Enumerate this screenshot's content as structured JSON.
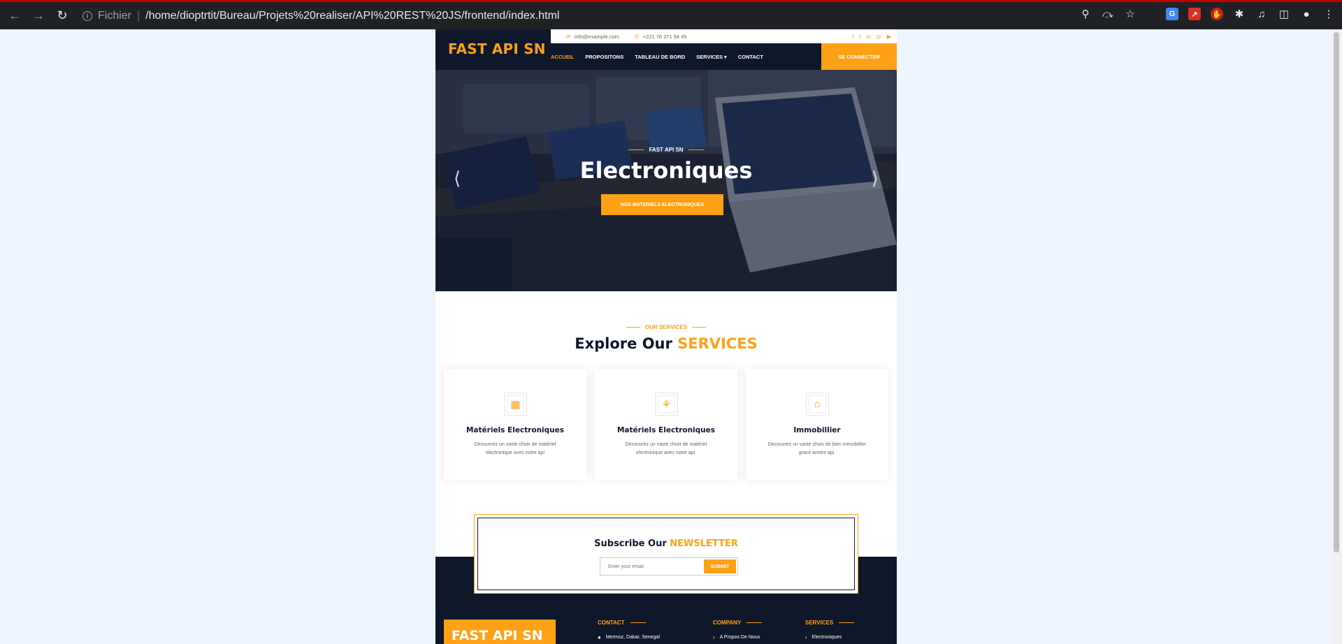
{
  "browser": {
    "scheme_label": "Fichier",
    "url": "/home/dioptrtit/Bureau/Projets%20realiser/API%20REST%20JS/frontend/index.html"
  },
  "site": {
    "brand": "FAST API SN",
    "topbar": {
      "email": "info@example.com",
      "phone": "+221 78 371 94 45",
      "socials": [
        "facebook-icon",
        "twitter-icon",
        "linkedin-icon",
        "instagram-icon",
        "youtube-icon"
      ]
    },
    "menu": [
      "ACCUEIL",
      "PROPOSITONS",
      "TABLEAU DE BORD",
      "SERVICES",
      "CONTACT"
    ],
    "login_label": "SE CONNECTER"
  },
  "hero": {
    "eyebrow": "FAST API SN",
    "title": "Electroniques",
    "button": "NOS MATERIELS ELECTRONIQUES"
  },
  "services": {
    "eyebrow": "OUR SERVICES",
    "title_prefix": "Explore Our",
    "title_highlight": "SERVICES",
    "cards": [
      {
        "icon": "hotel-icon",
        "title": "Matériels Electroniques",
        "desc": "Decouvrez un vaste choix de matériel electronique avec notre api"
      },
      {
        "icon": "utensils-icon",
        "title": "Matériels Electroniques",
        "desc": "Decouvrez un vaste choix de matériel electronique avec notre api."
      },
      {
        "icon": "bank-icon",
        "title": "Immobillier",
        "desc": "Decouvrez un vaste choix de bien immobillier grace anotre api."
      }
    ]
  },
  "newsletter": {
    "title_prefix": "Subscribe Our",
    "title_highlight": "NEWSLETTER",
    "placeholder": "Enter your email",
    "submit": "SUBMIT"
  },
  "footer": {
    "brand": "FAST API SN",
    "columns": [
      {
        "heading": "CONTACT",
        "first_item": "Mermoz, Dakar, Senegal"
      },
      {
        "heading": "COMPANY",
        "first_item": "A Propos De Nous"
      },
      {
        "heading": "SERVICES",
        "first_item": "Electroniques"
      }
    ]
  },
  "colors": {
    "accent": "#fea116",
    "dark": "#0f172b"
  }
}
